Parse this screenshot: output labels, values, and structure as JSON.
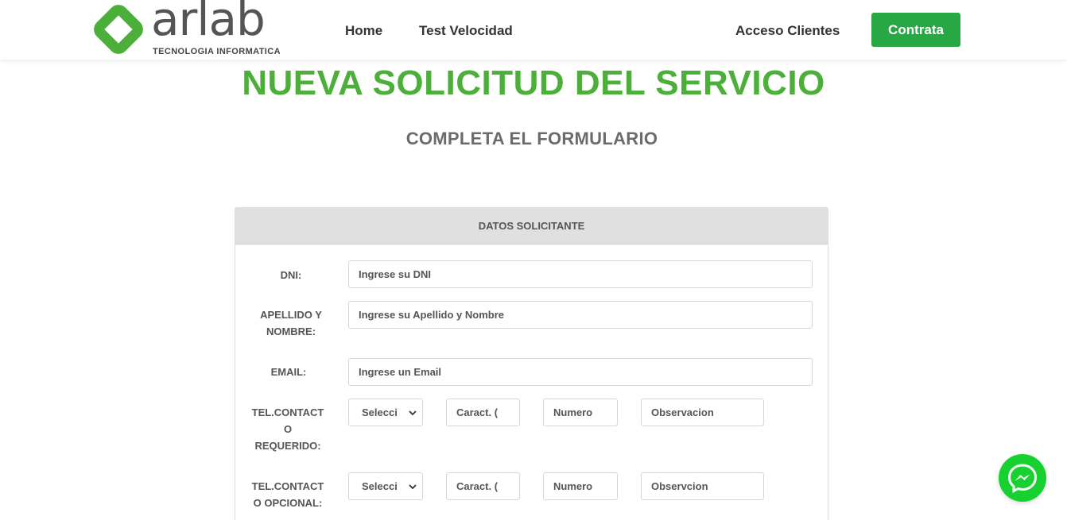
{
  "brand": {
    "name": "arlab",
    "tagline": "TECNOLOGIA INFORMATICA",
    "color": "#4caf3a"
  },
  "nav": {
    "home": "Home",
    "test": "Test Velocidad",
    "acceso": "Acceso Clientes",
    "contrata": "Contrata"
  },
  "page": {
    "title": "NUEVA SOLICITUD DEL SERVICIO",
    "subtitle": "COMPLETA EL FORMULARIO"
  },
  "form": {
    "section_title": "DATOS SOLICITANTE",
    "dni": {
      "label": "DNI:",
      "placeholder": "Ingrese su DNI"
    },
    "nombre": {
      "label_line1": "APELLIDO Y",
      "label_line2": "NOMBRE:",
      "placeholder": "Ingrese su Apellido y Nombre"
    },
    "email": {
      "label": "EMAIL:",
      "placeholder": "Ingrese un Email"
    },
    "tel_requerido": {
      "label_line1": "TEL.CONTACT",
      "label_line2": "O",
      "label_line3": "REQUERIDO:",
      "select": "Selecci",
      "caract": "Caract. (",
      "numero": "Numero",
      "observacion": "Observacion"
    },
    "tel_opcional": {
      "label_line1": "TEL.CONTACT",
      "label_line2": "O OPCIONAL:",
      "select": "Selecci",
      "caract": "Caract. (",
      "numero": "Numero",
      "observacion": "Observcion"
    }
  },
  "colors": {
    "button_green": "#28a745",
    "messenger_green": "#17d130"
  },
  "icons": {
    "messenger": "messenger-icon",
    "select_chevron": "chevron-down-icon",
    "logo": "arlab-diamond-logo"
  }
}
